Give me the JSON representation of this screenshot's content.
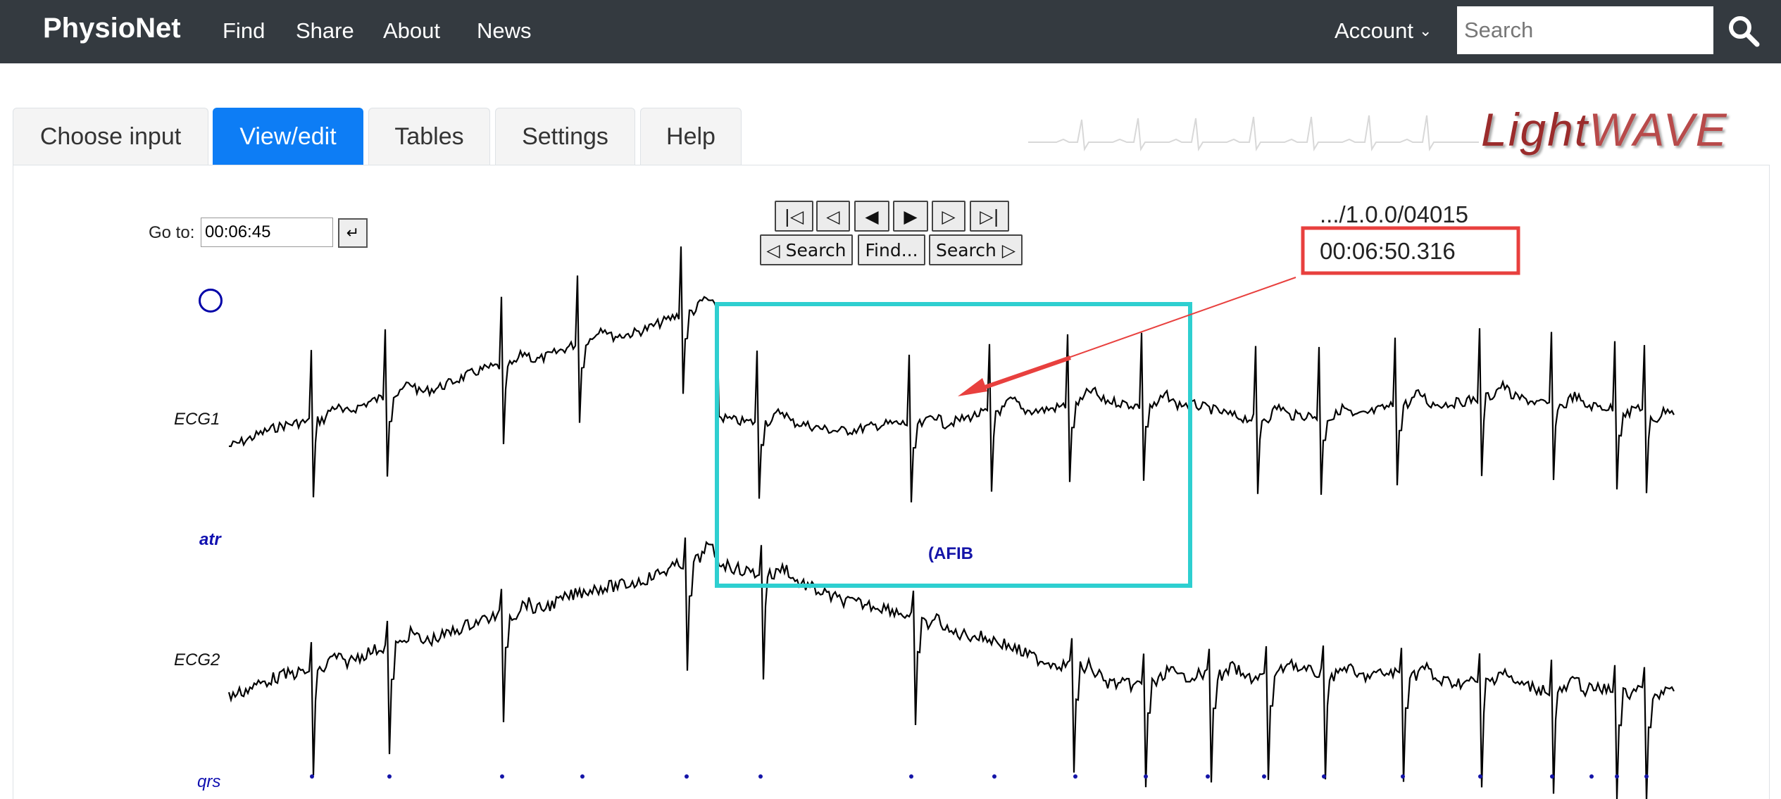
{
  "navbar": {
    "brand": "PhysioNet",
    "links": [
      "Find",
      "Share",
      "About",
      "News"
    ],
    "account": "Account",
    "search_placeholder": "Search"
  },
  "tabs": [
    {
      "label": "Choose input",
      "active": false
    },
    {
      "label": "View/edit",
      "active": true
    },
    {
      "label": "Tables",
      "active": false
    },
    {
      "label": "Settings",
      "active": false
    },
    {
      "label": "Help",
      "active": false
    }
  ],
  "logo": {
    "light": "Light",
    "wave": "WAVE"
  },
  "goto": {
    "label": "Go to:",
    "value": "00:06:45",
    "button_icon": "return-arrow-icon"
  },
  "controls": {
    "row1": [
      "|◁",
      "◁",
      "◀",
      "▶",
      "▷",
      "▷|"
    ],
    "search_back": "◁ Search",
    "find": "Find...",
    "search_forward": "Search ▷"
  },
  "record": {
    "path": ".../1.0.0/04015",
    "time": "00:06:50.316"
  },
  "signals": {
    "ecg1": "ECG1",
    "ecg2": "ECG2"
  },
  "annotators": {
    "atr": "atr",
    "qrs": "qrs"
  },
  "annotations": {
    "afib": "(AFIB"
  },
  "colors": {
    "navbar": "#343a40",
    "active_tab": "#0d7df5",
    "highlight_box": "#2ecfd0",
    "callout": "#e8403e",
    "annotation": "#1414a8"
  }
}
